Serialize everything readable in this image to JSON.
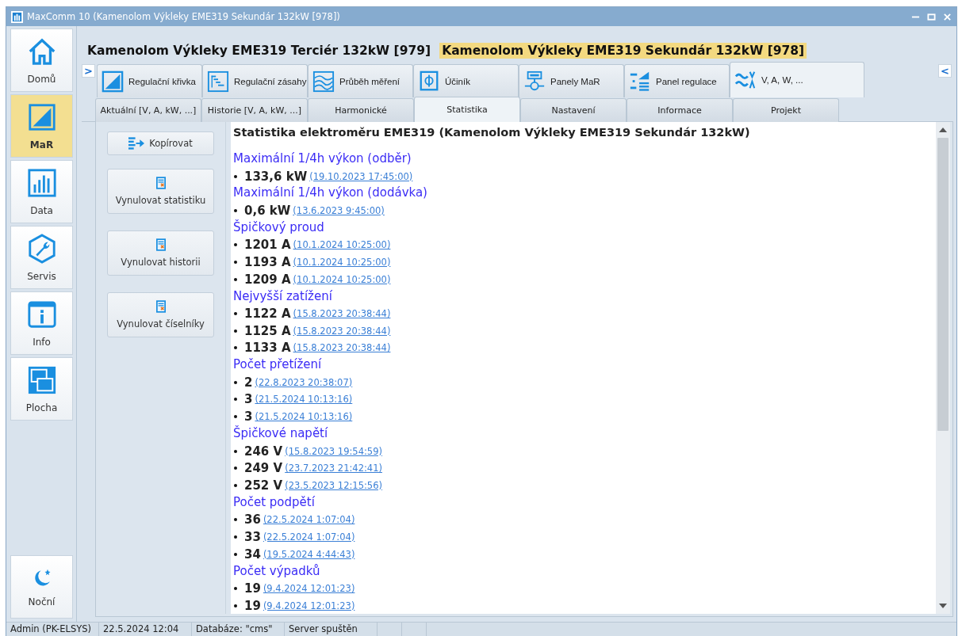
{
  "window": {
    "title": "MaxComm 10 (Kamenolom Výkleky EME319 Sekundár 132kW [978])"
  },
  "sidebar": {
    "items": [
      {
        "label": "Domů",
        "selected": false
      },
      {
        "label": "MaR",
        "selected": true
      },
      {
        "label": "Data",
        "selected": false
      },
      {
        "label": "Servis",
        "selected": false
      },
      {
        "label": "Info",
        "selected": false
      },
      {
        "label": "Plocha",
        "selected": false
      }
    ],
    "bottom_item": {
      "label": "Noční"
    }
  },
  "devices": [
    {
      "label": "Kamenolom Výkleky EME319 Terciér 132kW [979]",
      "selected": false
    },
    {
      "label": "Kamenolom Výkleky EME319 Sekundár 132kW [978]",
      "selected": true
    }
  ],
  "expand_left": ">",
  "expand_right": "<",
  "top_tabs": [
    {
      "label": "Regulační křivka",
      "selected": false
    },
    {
      "label": "Regulační zásahy",
      "selected": false
    },
    {
      "label": "Průběh měření",
      "selected": false
    },
    {
      "label": "Účiník",
      "selected": false
    },
    {
      "label": "Panely MaR",
      "selected": false
    },
    {
      "label": "Panel regulace",
      "selected": false
    },
    {
      "label": "V, A, W, ...",
      "selected": true
    }
  ],
  "sub_tabs": [
    {
      "label": "Aktuální [V, A, kW, ...]",
      "selected": false
    },
    {
      "label": "Historie [V, A, kW, ...]",
      "selected": false
    },
    {
      "label": "Harmonické",
      "selected": false
    },
    {
      "label": "Statistika",
      "selected": true
    },
    {
      "label": "Nastavení",
      "selected": false
    },
    {
      "label": "Informace",
      "selected": false
    },
    {
      "label": "Projekt",
      "selected": false
    }
  ],
  "actions": [
    "Kopírovat",
    "Vynulovat statistiku",
    "Vynulovat historii",
    "Vynulovat číselníky"
  ],
  "report": {
    "title": "Statistika elektroměru EME319 (Kamenolom Výkleky EME319 Sekundár 132kW)",
    "sections": [
      {
        "heading": "Maximální 1/4h výkon (odběr)",
        "entries": [
          {
            "value": "133,6 kW",
            "time": "(19.10.2023 17:45:00)"
          }
        ]
      },
      {
        "heading": "Maximální 1/4h výkon (dodávka)",
        "entries": [
          {
            "value": "0,6 kW",
            "time": "(13.6.2023 9:45:00)"
          }
        ]
      },
      {
        "heading": "Špičkový proud",
        "entries": [
          {
            "value": "1201 A",
            "time": "(10.1.2024 10:25:00)"
          },
          {
            "value": "1193 A",
            "time": "(10.1.2024 10:25:00)"
          },
          {
            "value": "1209 A",
            "time": "(10.1.2024 10:25:00)"
          }
        ]
      },
      {
        "heading": "Nejvyšší zatížení",
        "entries": [
          {
            "value": "1122 A",
            "time": "(15.8.2023 20:38:44)"
          },
          {
            "value": "1125 A",
            "time": "(15.8.2023 20:38:44)"
          },
          {
            "value": "1133 A",
            "time": "(15.8.2023 20:38:44)"
          }
        ]
      },
      {
        "heading": "Počet přetížení",
        "entries": [
          {
            "value": "2",
            "time": "(22.8.2023 20:38:07)"
          },
          {
            "value": "3",
            "time": "(21.5.2024 10:13:16)"
          },
          {
            "value": "3",
            "time": "(21.5.2024 10:13:16)"
          }
        ]
      },
      {
        "heading": "Špičkové napětí",
        "entries": [
          {
            "value": "246 V",
            "time": "(15.8.2023 19:54:59)"
          },
          {
            "value": "249 V",
            "time": "(23.7.2023 21:42:41)"
          },
          {
            "value": "252 V",
            "time": "(23.5.2023 12:15:56)"
          }
        ]
      },
      {
        "heading": "Počet podpětí",
        "entries": [
          {
            "value": "36",
            "time": "(22.5.2024 1:07:04)"
          },
          {
            "value": "33",
            "time": "(22.5.2024 1:07:04)"
          },
          {
            "value": "34",
            "time": "(19.5.2024 4:44:43)"
          }
        ]
      },
      {
        "heading": "Počet výpadků",
        "entries": [
          {
            "value": "19",
            "time": "(9.4.2024 12:01:23)"
          },
          {
            "value": "19",
            "time": "(9.4.2024 12:01:23)"
          }
        ]
      }
    ]
  },
  "status_bar": [
    "Admin (PK-ELSYS)",
    "22.5.2024 12:04",
    "Databáze: \"cms\"",
    "Server spuštěn"
  ]
}
